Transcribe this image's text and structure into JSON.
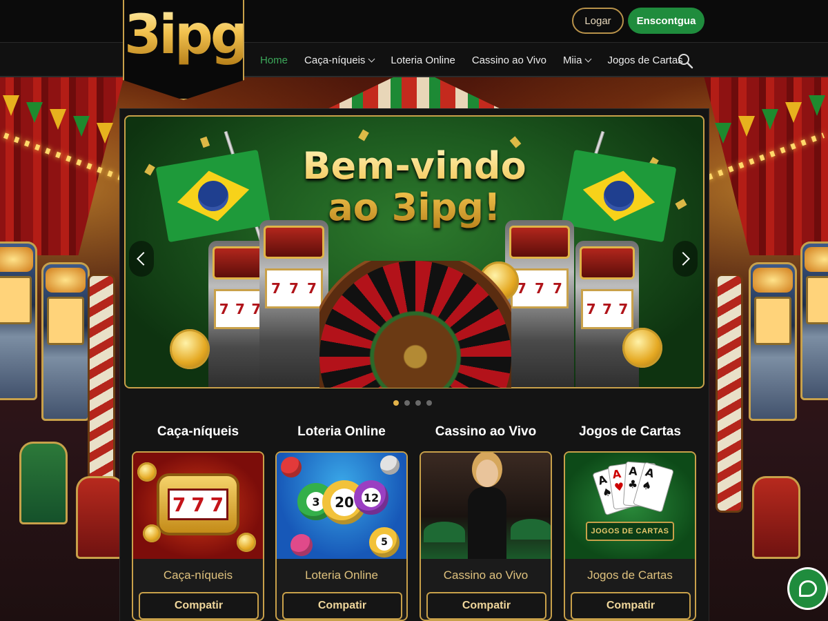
{
  "brand": {
    "logo_text": "3ipg"
  },
  "header": {
    "login_label": "Logar",
    "register_label": "Enscontgua"
  },
  "nav": {
    "items": [
      {
        "label": "Home",
        "active": true,
        "dropdown": false
      },
      {
        "label": "Caça-níqueis",
        "active": false,
        "dropdown": true
      },
      {
        "label": "Loteria Online",
        "active": false,
        "dropdown": false
      },
      {
        "label": "Cassino ao Vivo",
        "active": false,
        "dropdown": false
      },
      {
        "label": "Miia",
        "active": false,
        "dropdown": true
      },
      {
        "label": "Jogos de Cartas",
        "active": false,
        "dropdown": false
      }
    ],
    "search_icon": "search-icon"
  },
  "hero": {
    "headline_line1": "Bem-vindo",
    "headline_line2": "ao 3ipg!",
    "slot_reels": [
      "7",
      "7",
      "7"
    ],
    "slide_count": 4,
    "active_slide": 1,
    "prev_icon": "chevron-left-icon",
    "next_icon": "chevron-right-icon"
  },
  "categories": [
    {
      "title": "Caça-níqueis",
      "label": "Caça-níqueis",
      "button": "Compatir",
      "reels": [
        "7",
        "7",
        "7"
      ]
    },
    {
      "title": "Loteria Online",
      "label": "Loteria Online",
      "button": "Compatir",
      "balls": [
        "3",
        "20",
        "12",
        "5"
      ]
    },
    {
      "title": "Cassino ao Vivo",
      "label": "Cassino ao Vivo",
      "button": "Compatir"
    },
    {
      "title": "Jogos de Cartas",
      "label": "Jogos de Cartas",
      "button": "Compatir",
      "banner": "JOGOS DE CARTAS"
    }
  ],
  "chat": {
    "icon": "chat-bubble-icon"
  },
  "colors": {
    "accent_gold": "#c9a14a",
    "brand_green": "#1f8c3d",
    "active_nav": "#3ca85a",
    "panel_bg": "#141414"
  }
}
